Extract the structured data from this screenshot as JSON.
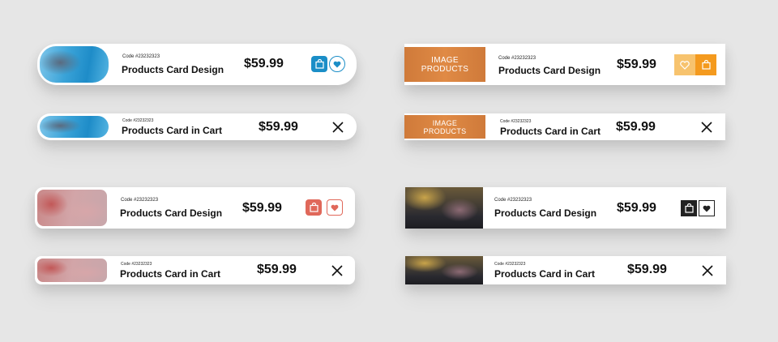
{
  "code": "Code #23232323",
  "price": "$59.99",
  "title_design": "Products Card Design",
  "title_cart": "Products Card in Cart",
  "image_placeholder": [
    "IMAGE",
    "PRODUCTS"
  ],
  "colors": {
    "background": "#e6e6e6",
    "blue": "#1b8ec7",
    "red": "#e0685a",
    "orange": "#f49a1e",
    "orange_light": "#f7c36e",
    "black": "#222222"
  },
  "icons": [
    "bag-icon",
    "heart-icon",
    "close-icon"
  ]
}
